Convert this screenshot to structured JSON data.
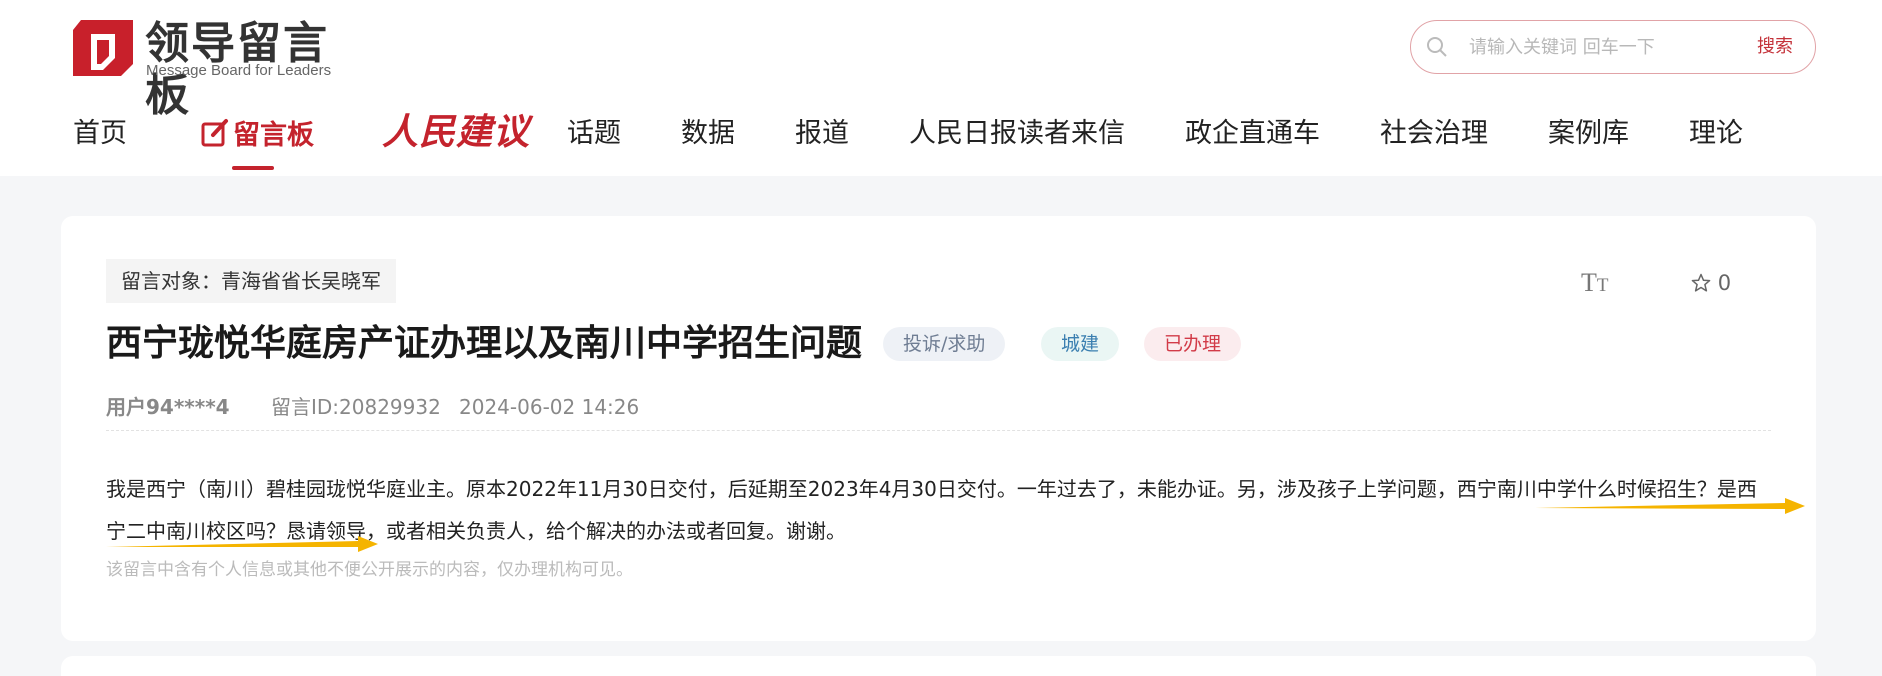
{
  "logo": {
    "title": "领导留言板",
    "subtitle": "Message Board for Leaders",
    "icon": "logo-mark-icon"
  },
  "search": {
    "placeholder": "请输入关键词 回车一下",
    "button_label": "搜索",
    "icon": "search-icon"
  },
  "nav": {
    "items": [
      {
        "label": "首页"
      },
      {
        "label": "留言板",
        "active": true,
        "icon": "edit-icon"
      },
      {
        "label": "人民建议"
      },
      {
        "label": "话题"
      },
      {
        "label": "数据"
      },
      {
        "label": "报道"
      },
      {
        "label": "人民日报读者来信"
      },
      {
        "label": "政企直通车"
      },
      {
        "label": "社会治理"
      },
      {
        "label": "案例库"
      },
      {
        "label": "理论"
      }
    ]
  },
  "message": {
    "target": "留言对象：青海省省长吴晓军",
    "font_toggle": "Tт",
    "favorite_count": "0",
    "title": "西宁珑悦华庭房产证办理以及南川中学招生问题",
    "tags": {
      "type": "投诉/求助",
      "field": "城建",
      "status": "已办理"
    },
    "user": "用户94****4",
    "id": "留言ID:20829932",
    "time": "2024-06-02 14:26",
    "content": "我是西宁（南川）碧桂园珑悦华庭业主。原本2022年11月30日交付，后延期至2023年4月30日交付。一年过去了，未能办证。另，涉及孩子上学问题，西宁南川中学什么时候招生？是西宁二中南川校区吗？恳请领导，或者相关负责人，给个解决的办法或者回复。谢谢。",
    "privacy_note": "该留言中含有个人信息或其他不便公开展示的内容，仅办理机构可见。"
  },
  "colors": {
    "brand_red": "#c4232d",
    "arrow_yellow": "#f5b400",
    "page_bg": "#f5f6f8"
  }
}
